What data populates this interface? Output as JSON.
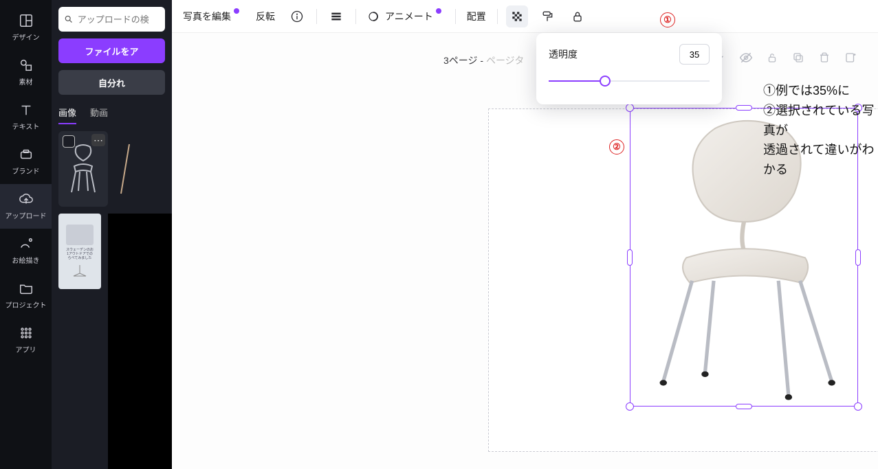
{
  "rail": {
    "design": "デザイン",
    "elements": "素材",
    "text": "テキスト",
    "brand": "ブランド",
    "upload": "アップロード",
    "draw": "お絵描き",
    "projects": "プロジェクト",
    "apps": "アプリ"
  },
  "panel": {
    "search_placeholder": "アップロードの検",
    "upload_btn": "ファイルをア",
    "record_btn": "自分れ",
    "tab_image": "画像",
    "tab_video": "動画"
  },
  "toolbar": {
    "edit_photo": "写真を編集",
    "flip": "反転",
    "animate": "アニメート",
    "position": "配置"
  },
  "popover": {
    "label": "透明度",
    "value": "35",
    "percent": 35
  },
  "pagehdr": {
    "prefix": "3ページ - ",
    "suffix": "ページタ"
  },
  "annotations": {
    "m1": "①",
    "m2": "②",
    "line1": "①例では35%に",
    "line2": "②選択されている写真が",
    "line3": "透過されて違いがわかる"
  }
}
